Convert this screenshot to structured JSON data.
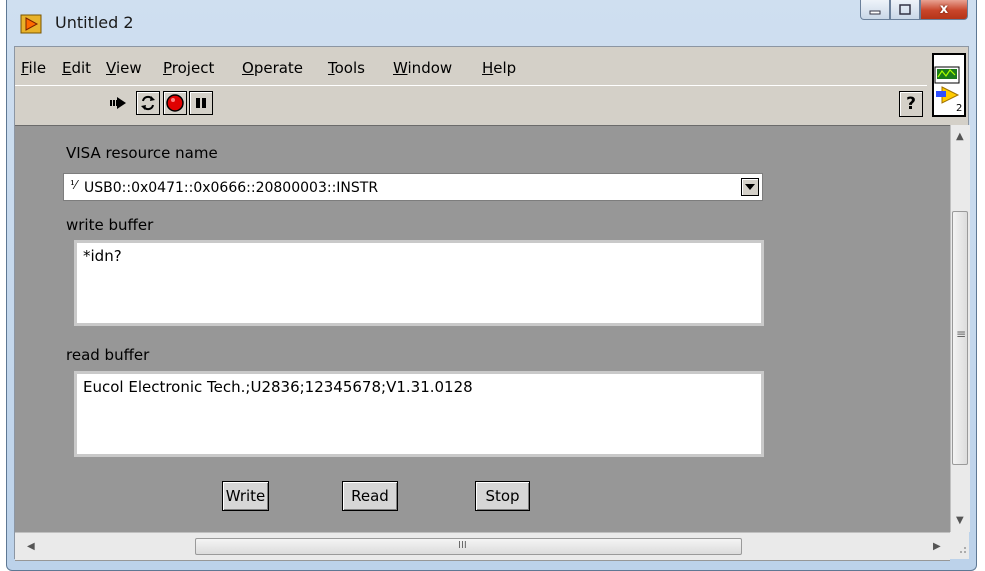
{
  "window": {
    "title": "Untitled 2",
    "controls": {
      "minimize": "—",
      "maximize": "☐",
      "close": "x"
    }
  },
  "menubar": {
    "items": [
      {
        "key": "F",
        "rest": "ile"
      },
      {
        "key": "E",
        "rest": "dit"
      },
      {
        "key": "V",
        "rest": "iew"
      },
      {
        "key": "P",
        "rest": "roject"
      },
      {
        "key": "O",
        "rest": "perate"
      },
      {
        "key": "T",
        "rest": "ools"
      },
      {
        "key": "W",
        "rest": "indow"
      },
      {
        "key": "H",
        "rest": "elp"
      }
    ]
  },
  "toolbar": {
    "buttons": [
      "run-arrow-icon",
      "run-continuously-icon",
      "abort-stop-icon",
      "pause-icon"
    ],
    "help": "?",
    "vi_icon_number": "2"
  },
  "panel": {
    "visa_label": "VISA resource name",
    "visa_icon": "I/O",
    "visa_value": "USB0::0x0471::0x0666::20800003::INSTR",
    "write_label": "write buffer",
    "write_value": "*idn?",
    "read_label": "read buffer",
    "read_value": "Eucol Electronic Tech.;U2836;12345678;V1.31.0128",
    "buttons": {
      "write": "Write",
      "read": "Read",
      "stop": "Stop"
    }
  },
  "scrollbars": {
    "h_grip": "III",
    "v_grip": "≡"
  },
  "colors": {
    "panel_bg": "#979797",
    "window_frame": "#bcd2ea",
    "close_red": "#c8452a"
  }
}
